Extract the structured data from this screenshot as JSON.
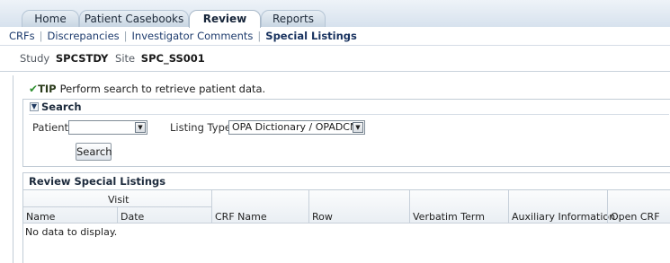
{
  "tabs": [
    {
      "label": "Home",
      "active": false
    },
    {
      "label": "Patient Casebooks",
      "active": false
    },
    {
      "label": "Review",
      "active": true
    },
    {
      "label": "Reports",
      "active": false
    }
  ],
  "subnav": {
    "items": [
      "CRFs",
      "Discrepancies",
      "Investigator Comments",
      "Special Listings"
    ],
    "current": "Special Listings"
  },
  "study": {
    "study_label": "Study",
    "study_value": "SPCSTDY",
    "site_label": "Site",
    "site_value": "SPC_SS001"
  },
  "tip": {
    "icon": "check-icon",
    "label": "TIP",
    "text": "Perform search to retrieve patient data."
  },
  "search": {
    "title": "Search",
    "patient_label": "Patient",
    "patient_value": "",
    "listing_type_label": "Listing Type",
    "listing_type_value": "OPA Dictionary / OPADCM",
    "button_label": "Search"
  },
  "review": {
    "title": "Review Special Listings",
    "group_header": "Visit",
    "columns": [
      "Name",
      "Date",
      "CRF Name",
      "Row",
      "Verbatim Term",
      "Auxiliary Information",
      "Open CRF"
    ],
    "empty_text": "No data to display."
  },
  "colors": {
    "link": "#1d3b6d",
    "tip_check": "#2f8f2f",
    "border": "#c2ccd6"
  }
}
